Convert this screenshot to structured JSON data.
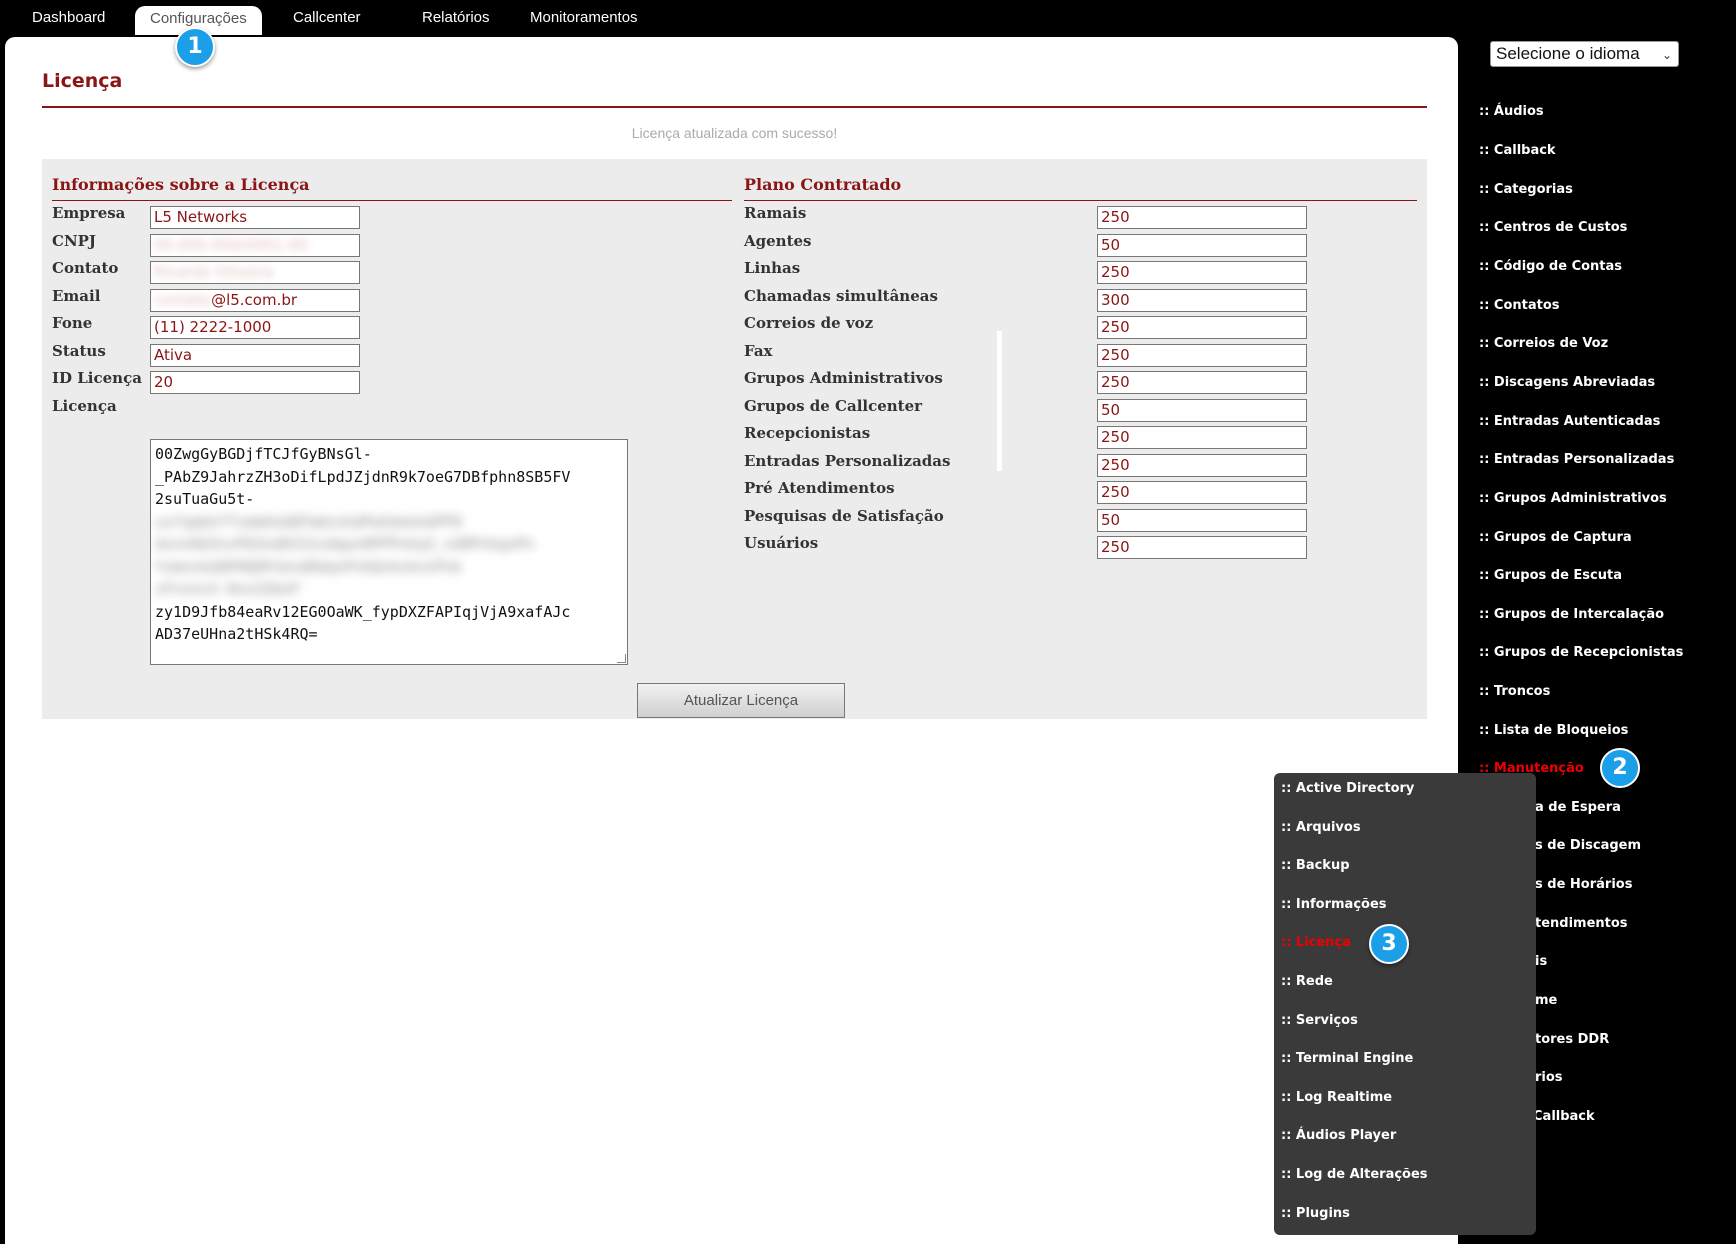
{
  "top_nav": {
    "tabs": [
      {
        "label": "Dashboard"
      },
      {
        "label": "Configurações"
      },
      {
        "label": "Callcenter"
      },
      {
        "label": "Relatórios"
      },
      {
        "label": "Monitoramentos"
      }
    ],
    "active_tab": "Configurações"
  },
  "page": {
    "title": "Licença",
    "success_message": "Licença atualizada com sucesso!"
  },
  "license_info": {
    "title": "Informações sobre a Licença",
    "fields": [
      {
        "label": "Empresa",
        "value": "L5 Networks"
      },
      {
        "label": "CNPJ",
        "value": "00.000.000/0001-00"
      },
      {
        "label": "Contato",
        "value": "Ricardo Oliveira"
      },
      {
        "label": "Email",
        "value_hidden": "contato",
        "value_visible": "@l5.com.br"
      },
      {
        "label": "Fone",
        "value": "(11) 2222-1000"
      },
      {
        "label": "Status",
        "value": "Ativa"
      },
      {
        "label": "ID Licença",
        "value": "20"
      },
      {
        "label": "Licença"
      }
    ],
    "license_text_lines": [
      "00ZwgGyBGDjfTCJfGyBNsGl-",
      "_PAbZ9JahrzZH3oDifLpdJZjdnR9k7oeG7DBfphn8SB5FV",
      "2suTuaGu5t-",
      "uxfqqkkfTxmmkkdQFmmnxkdPwhkmnkdPP0",
      "dxnnHd3nxPQ3nd0331ndqwn0PPPnkq3_nd0PnkqnPn",
      "YnmnnkdQP0Q0Pnknd0dqnPnkQnknknnPnk",
      "zFnnnn3-0nnZZmnP",
      "zy1D9Jfb84eaRv12EG0OaWK_fypDXZFAPIqjVjA9xafAJc",
      "AD37eUHna2tHSk4RQ="
    ],
    "update_button": "Atualizar Licença"
  },
  "plan": {
    "title": "Plano Contratado",
    "fields": [
      {
        "label": "Ramais",
        "value": "250"
      },
      {
        "label": "Agentes",
        "value": "50"
      },
      {
        "label": "Linhas",
        "value": "250"
      },
      {
        "label": "Chamadas simultâneas",
        "value": "300"
      },
      {
        "label": "Correios de voz",
        "value": "250"
      },
      {
        "label": "Fax",
        "value": "250"
      },
      {
        "label": "Grupos Administrativos",
        "value": "250"
      },
      {
        "label": "Grupos de Callcenter",
        "value": "50"
      },
      {
        "label": "Recepcionistas",
        "value": "250"
      },
      {
        "label": "Entradas Personalizadas",
        "value": "250"
      },
      {
        "label": "Pré Atendimentos",
        "value": "250"
      },
      {
        "label": "Pesquisas de Satisfação",
        "value": "50"
      },
      {
        "label": "Usuários",
        "value": "250"
      }
    ]
  },
  "language_select": {
    "selected": "Selecione o idioma"
  },
  "right_menu": {
    "items": [
      ":: Áudios",
      ":: Callback",
      ":: Categorias",
      ":: Centros de Custos",
      ":: Código de Contas",
      ":: Contatos",
      ":: Correios de Voz",
      ":: Discagens Abreviadas",
      ":: Entradas Autenticadas",
      ":: Entradas Personalizadas",
      ":: Grupos Administrativos",
      ":: Grupos de Captura",
      ":: Grupos de Escuta",
      ":: Grupos de Intercalação",
      ":: Grupos de Recepcionistas",
      ":: Troncos",
      ":: Lista de Bloqueios",
      ":: Manutenção",
      "a de Espera",
      "s de Discagem",
      "s de Horários",
      "tendimentos",
      "is",
      "me",
      "tores DDR",
      "rios",
      "Callback"
    ],
    "active_item": ":: Manutenção"
  },
  "submenu": {
    "items": [
      ":: Active Directory",
      ":: Arquivos",
      ":: Backup",
      ":: Informações",
      ":: Licença",
      ":: Rede",
      ":: Serviços",
      ":: Terminal Engine",
      ":: Log Realtime",
      ":: Áudios Player",
      ":: Log de Alterações",
      ":: Plugins"
    ],
    "active_item": ":: Licença"
  },
  "step_badges": [
    "1",
    "2",
    "3"
  ],
  "colors": {
    "brand_red": "#8b1515",
    "active_menu_red": "#ee0000",
    "badge_blue": "#1a9fe8",
    "panel_gray": "#ececec"
  }
}
